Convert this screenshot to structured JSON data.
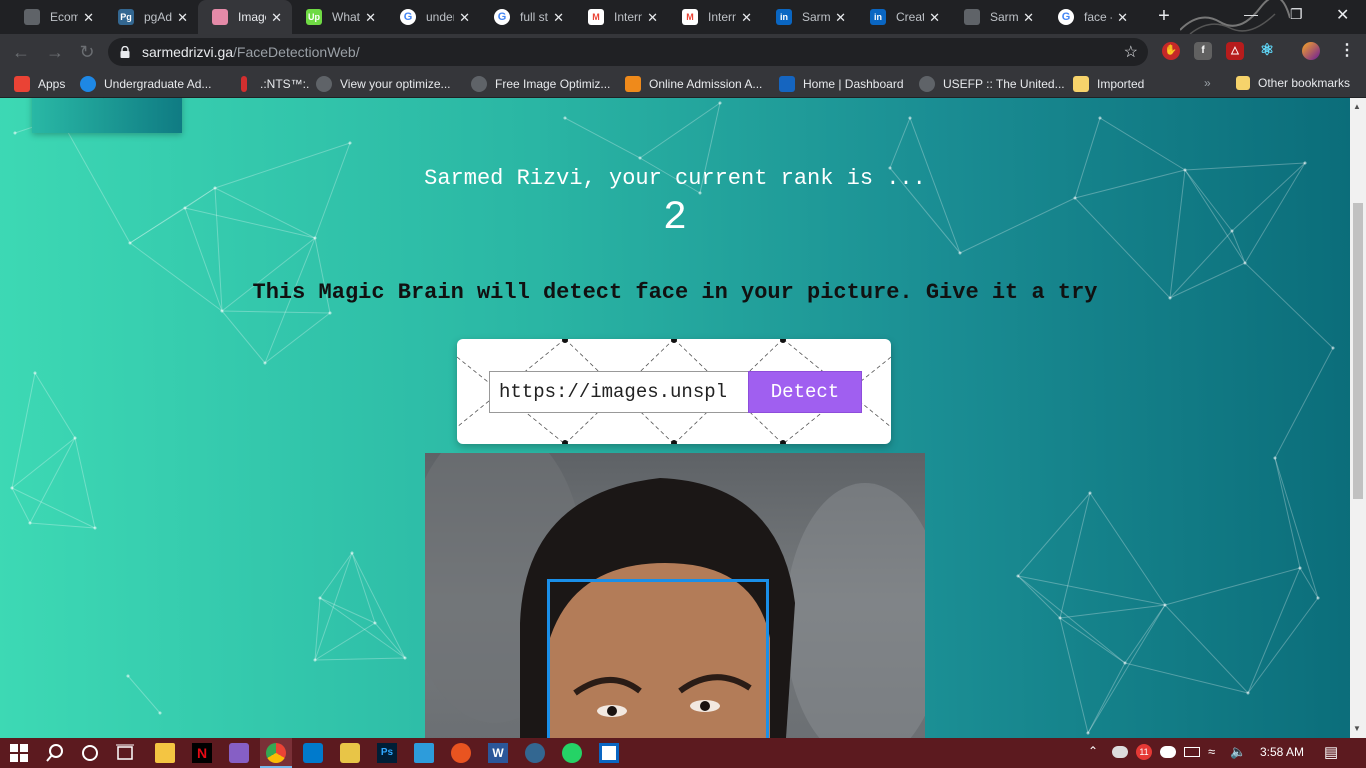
{
  "browser": {
    "tabs": [
      {
        "title": "Ecom",
        "icon": "gmail-gray-icon",
        "color": "#5f6368",
        "glyph": ""
      },
      {
        "title": "pgAd",
        "icon": "pgadmin-icon",
        "color": "#336791",
        "glyph": "Pg"
      },
      {
        "title": "Image",
        "icon": "brain-icon",
        "color": "#e58aa8",
        "glyph": "",
        "active": true
      },
      {
        "title": "What",
        "icon": "upwork-icon",
        "color": "#6fda44",
        "glyph": "Up"
      },
      {
        "title": "under",
        "icon": "google-icon",
        "color": "#ffffff",
        "glyph": "G"
      },
      {
        "title": "full st",
        "icon": "google-icon",
        "color": "#ffffff",
        "glyph": "G"
      },
      {
        "title": "Intern",
        "icon": "gmail-icon",
        "color": "#ea4335",
        "glyph": "M"
      },
      {
        "title": "Intern",
        "icon": "gmail-icon",
        "color": "#ea4335",
        "glyph": "M"
      },
      {
        "title": "Sarme",
        "icon": "linkedin-icon",
        "color": "#0a66c2",
        "glyph": "in"
      },
      {
        "title": "Creati",
        "icon": "linkedin-icon",
        "color": "#0a66c2",
        "glyph": "in"
      },
      {
        "title": "Sarme",
        "icon": "globe-icon",
        "color": "#5f6368",
        "glyph": ""
      },
      {
        "title": "face -",
        "icon": "google-icon",
        "color": "#ffffff",
        "glyph": "G"
      }
    ],
    "address": {
      "domain": "sarmedrizvi.ga",
      "path": "/FaceDetectionWeb/"
    },
    "bookmarks": [
      {
        "label": "Apps",
        "icon": "apps-grid-icon",
        "color": "#ea4335"
      },
      {
        "label": "Undergraduate Ad...",
        "icon": "compass-icon",
        "color": "#1e88e5"
      },
      {
        "label": ".:NTS™:.",
        "icon": "nts-icon",
        "color": "#d32f2f"
      },
      {
        "label": "View your optimize...",
        "icon": "globe-icon",
        "color": "#5f6368"
      },
      {
        "label": "Free Image Optimiz...",
        "icon": "globe-icon",
        "color": "#5f6368"
      },
      {
        "label": "Online Admission A...",
        "icon": "hat-icon",
        "color": "#ef8a1b"
      },
      {
        "label": "Home | Dashboard",
        "icon": "dashboard-icon",
        "color": "#1565c0"
      },
      {
        "label": "USEFP :: The United...",
        "icon": "globe-icon",
        "color": "#5f6368"
      },
      {
        "label": "Imported",
        "icon": "folder-icon",
        "color": "#f6d36b"
      }
    ],
    "other_bookmarks": "Other bookmarks",
    "overflow_chevron": "»"
  },
  "page": {
    "rank_text": "Sarmed Rizvi, your current rank is ...",
    "rank_value": "2",
    "tagline": "This Magic Brain will detect face in your picture. Give it a try",
    "url_input_value": "https://images.unspl",
    "detect_label": "Detect"
  },
  "taskbar": {
    "time": "3:58 AM",
    "notification_count": "11"
  },
  "colors": {
    "detect_button": "#a05ff0",
    "face_box": "#1a8fe8",
    "gradient_start": "#3dd9b4",
    "gradient_end": "#0b6d7a"
  }
}
